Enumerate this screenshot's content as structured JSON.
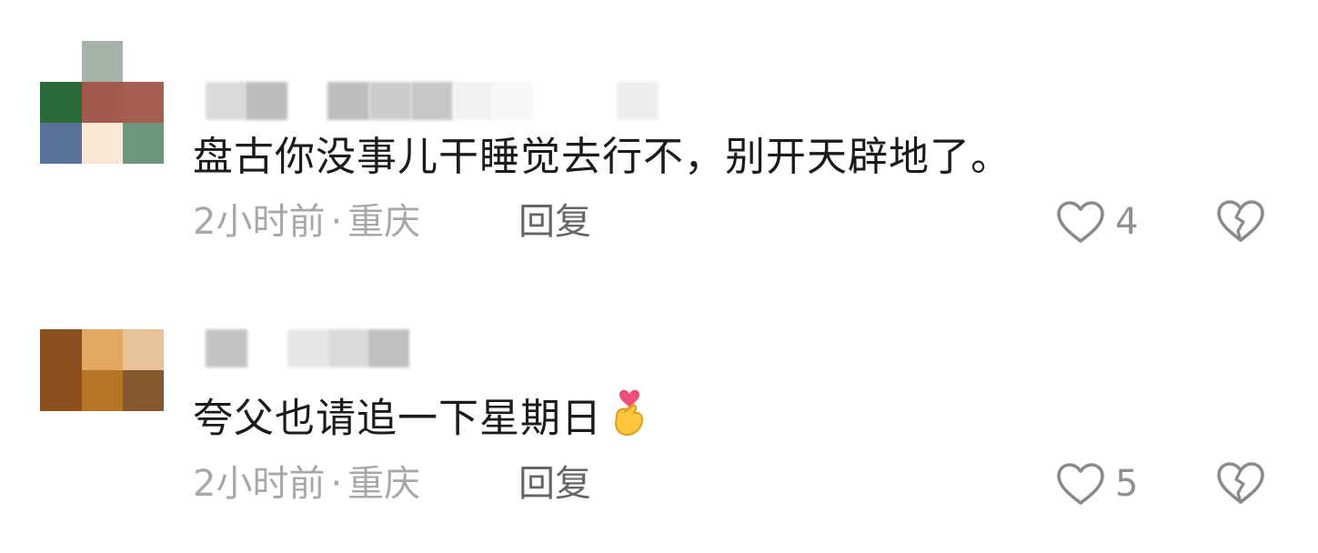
{
  "comments": [
    {
      "text": "盘古你没事儿干睡觉去行不，别开天辟地了。",
      "time": "2小时前",
      "location": "重庆",
      "reply_label": "回复",
      "like_count": "4",
      "like_icon": "heart-outline-icon",
      "dislike_icon": "broken-heart-icon",
      "avatar_colors": [
        [
          "#ffffff",
          "#a6b3ab",
          "#ffffff"
        ],
        [
          "#2a6a38",
          "#a25a4c",
          "#a55e4f"
        ],
        [
          "#5a739a",
          "#f9e8d6",
          "#6c957c"
        ]
      ]
    },
    {
      "text": "夸父也请追一下星期日",
      "emoji_icon": "finger-heart-emoji-icon",
      "time": "2小时前",
      "location": "重庆",
      "reply_label": "回复",
      "like_count": "5",
      "like_icon": "heart-outline-icon",
      "dislike_icon": "broken-heart-icon",
      "avatar_colors": [
        [
          "#8a5020",
          "#e2a762",
          "#e8c39a"
        ],
        [
          "#8c4f1e",
          "#b77424",
          "#865a30"
        ]
      ]
    }
  ],
  "separator": "·"
}
